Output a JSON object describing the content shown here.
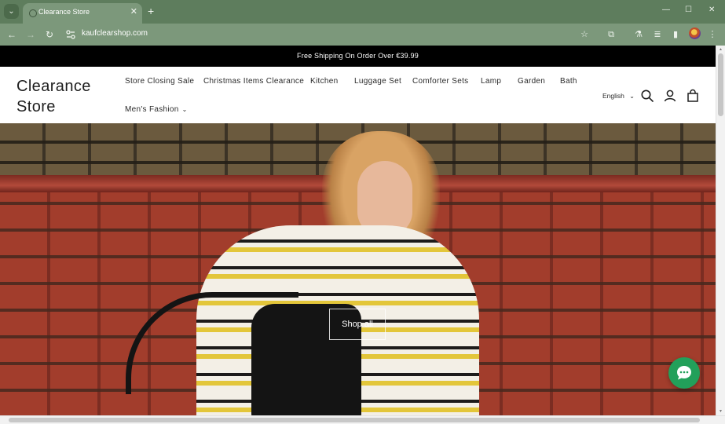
{
  "browser": {
    "tab_title": "Clearance Store",
    "url": "kaufclearshop.com",
    "new_tab_glyph": "+",
    "close_tab_glyph": "✕",
    "icons": [
      "tab-search-icon",
      "back-arrow-icon",
      "forward-arrow-icon",
      "reload-icon",
      "site-info-icon",
      "bookmark-star-icon",
      "extensions-icon",
      "labs-flask-icon",
      "reading-list-icon",
      "side-panel-icon",
      "profile-avatar-icon",
      "more-menu-icon",
      "minimize-icon",
      "maximize-icon",
      "close-window-icon"
    ]
  },
  "announcement": {
    "text": "Free Shipping On Order Over €39.99"
  },
  "header": {
    "logo": "Clearance Store",
    "nav": [
      {
        "label": "Store Closing Sale"
      },
      {
        "label": "Christmas Items Clearance"
      },
      {
        "label": "Kitchen"
      },
      {
        "label": "Luggage Set"
      },
      {
        "label": "Comforter Sets"
      },
      {
        "label": "Lamp"
      },
      {
        "label": "Garden"
      },
      {
        "label": "Bath"
      },
      {
        "label": "Men's Fashion"
      }
    ],
    "language": "English",
    "icons": [
      "search-icon",
      "account-icon",
      "cart-bag-icon"
    ]
  },
  "hero": {
    "cta_label": "Shop all"
  },
  "chat": {
    "icon": "chat-icon",
    "color": "#22a05a"
  },
  "colors": {
    "chrome_frame": "#5e7d5d",
    "chrome_toolbar": "#7c987b",
    "announcement_bg": "#000000"
  }
}
